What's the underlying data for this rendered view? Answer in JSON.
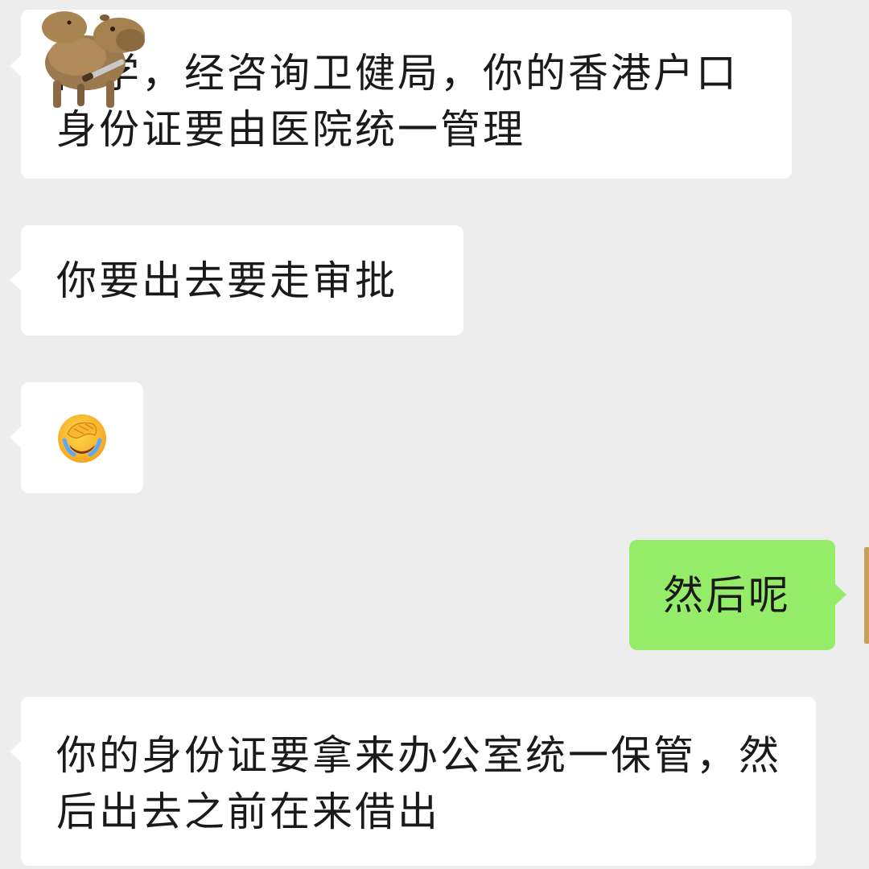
{
  "chat": {
    "messages": [
      {
        "side": "left",
        "text": "同学，经咨询卫健局，你的香港户口身份证要由医院统一管理"
      },
      {
        "side": "left",
        "text": "你要出去要走审批"
      },
      {
        "side": "left",
        "emoji": "face-palm-crying-emoji"
      },
      {
        "side": "right",
        "text": "然后呢"
      },
      {
        "side": "left",
        "text": "你的身份证要拿来办公室统一保管，然后出去之前在来借出"
      }
    ]
  },
  "sticker": {
    "icon": "capybara-with-knife-sticker"
  },
  "colors": {
    "background": "#ededed",
    "incoming_bubble": "#ffffff",
    "outgoing_bubble": "#95ec69",
    "text": "#1a1a1a"
  }
}
